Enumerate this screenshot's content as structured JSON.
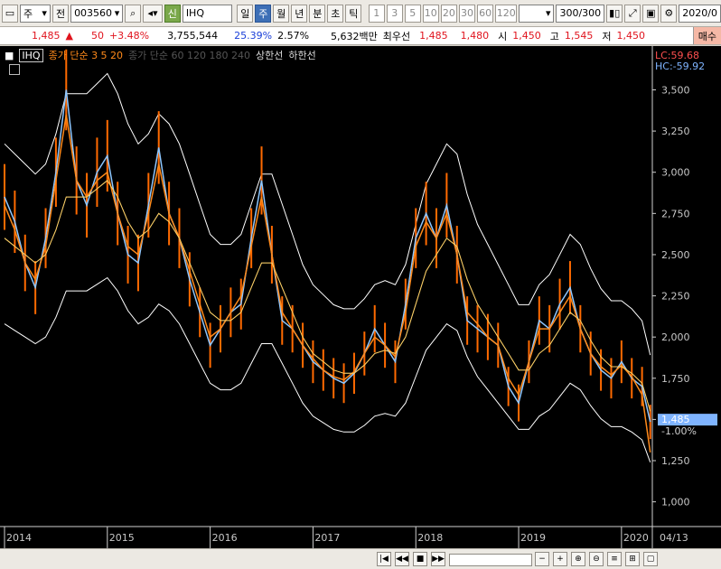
{
  "toolbar": {
    "period_label": "주",
    "market_label": "전",
    "code": "003560",
    "name_tag": "신",
    "name": "IHQ",
    "period_tabs": [
      "일",
      "주",
      "월",
      "년",
      "분",
      "초",
      "틱"
    ],
    "active_tab": "주",
    "intervals": [
      "1",
      "3",
      "5",
      "10",
      "20",
      "30",
      "60",
      "120"
    ],
    "count": "300",
    "count_total": "/300",
    "date": "2020/0"
  },
  "quote": {
    "price": "1,485",
    "change": "50",
    "pct": "+3.48%",
    "volume": "3,755,544",
    "vol_ratio": "25.39%",
    "turnover": "2.57%",
    "amount": "5,632백만",
    "best_label": "최우선",
    "best_ask": "1,485",
    "best_bid": "1,480",
    "open_label": "시",
    "open": "1,450",
    "high_label": "고",
    "high": "1,545",
    "low_label": "저",
    "low": "1,450",
    "buy_label": "매수"
  },
  "legend": {
    "code": "IHQ",
    "ma_text": "종가 단순 3  5  20",
    "ma_dim_text": "종가 단순 60  120  180  240",
    "upper": "상한선",
    "lower": "하한선"
  },
  "chart_labels": {
    "lc": "LC:59.68",
    "hc": "HC:-59.92",
    "last_price": "1,485",
    "last_pct": "-1.00%",
    "end_date": "04/13"
  },
  "colors": {
    "price_line": "#8ec7ff",
    "ma_fast": "#ff8a1a",
    "ma_mid": "#ffd060",
    "band": "#ffffff",
    "axis_text": "#c8c8c8"
  },
  "chart_data": {
    "type": "line",
    "title": "",
    "xlabel": "",
    "ylabel": "",
    "ylim": [
      850,
      3700
    ],
    "yticks": [
      1000,
      1250,
      1500,
      1750,
      2000,
      2250,
      2500,
      2750,
      3000,
      3250,
      3500
    ],
    "ytick_labels": [
      "1,000",
      "1,250",
      "1,500",
      "1,750",
      "2,000",
      "2,250",
      "2,500",
      "2,750",
      "3,000",
      "3,250",
      "3,500"
    ],
    "xlim": [
      2014.0,
      2020.3
    ],
    "xticks": [
      2014,
      2015,
      2016,
      2017,
      2018,
      2019,
      2020
    ],
    "xtick_labels": [
      "2014",
      "2015",
      "2016",
      "2017",
      "2018",
      "2019",
      "2020"
    ],
    "x": [
      2014.0,
      2014.1,
      2014.2,
      2014.3,
      2014.4,
      2014.5,
      2014.6,
      2014.7,
      2014.8,
      2014.9,
      2015.0,
      2015.1,
      2015.2,
      2015.3,
      2015.4,
      2015.5,
      2015.6,
      2015.7,
      2015.8,
      2015.9,
      2016.0,
      2016.1,
      2016.2,
      2016.3,
      2016.4,
      2016.5,
      2016.6,
      2016.7,
      2016.8,
      2016.9,
      2017.0,
      2017.1,
      2017.2,
      2017.3,
      2017.4,
      2017.5,
      2017.6,
      2017.7,
      2017.8,
      2017.9,
      2018.0,
      2018.1,
      2018.2,
      2018.3,
      2018.4,
      2018.5,
      2018.6,
      2018.7,
      2018.8,
      2018.9,
      2019.0,
      2019.1,
      2019.2,
      2019.3,
      2019.4,
      2019.5,
      2019.6,
      2019.7,
      2019.8,
      2019.9,
      2020.0,
      2020.1,
      2020.2,
      2020.28
    ],
    "series": [
      {
        "values": [
          2850,
          2700,
          2450,
          2300,
          2600,
          3000,
          3500,
          2950,
          2800,
          3000,
          3100,
          2750,
          2500,
          2450,
          2800,
          3150,
          2750,
          2600,
          2350,
          2150,
          1950,
          2050,
          2150,
          2200,
          2600,
          2950,
          2500,
          2100,
          2050,
          1950,
          1850,
          1800,
          1750,
          1720,
          1780,
          1900,
          2050,
          1950,
          1850,
          2200,
          2600,
          2750,
          2600,
          2800,
          2500,
          2100,
          2050,
          2000,
          1950,
          1700,
          1600,
          1850,
          2100,
          2050,
          2200,
          2300,
          2050,
          1900,
          1800,
          1750,
          1850,
          1750,
          1700,
          1485
        ]
      },
      {
        "values": [
          2800,
          2650,
          2450,
          2350,
          2550,
          2950,
          3350,
          2950,
          2850,
          2950,
          3000,
          2750,
          2550,
          2500,
          2750,
          3050,
          2750,
          2600,
          2400,
          2200,
          2000,
          2050,
          2150,
          2250,
          2550,
          2850,
          2500,
          2150,
          2050,
          1950,
          1870,
          1800,
          1760,
          1740,
          1790,
          1900,
          2000,
          1950,
          1880,
          2150,
          2550,
          2700,
          2600,
          2750,
          2500,
          2150,
          2080,
          2000,
          1950,
          1750,
          1650,
          1850,
          2050,
          2050,
          2150,
          2250,
          2050,
          1900,
          1820,
          1770,
          1830,
          1760,
          1650,
          1300
        ]
      },
      {
        "values": [
          2600,
          2550,
          2500,
          2450,
          2500,
          2650,
          2850,
          2850,
          2850,
          2900,
          2950,
          2850,
          2700,
          2600,
          2650,
          2750,
          2700,
          2600,
          2450,
          2300,
          2150,
          2100,
          2100,
          2150,
          2300,
          2450,
          2450,
          2300,
          2150,
          2000,
          1900,
          1850,
          1800,
          1780,
          1780,
          1830,
          1900,
          1920,
          1900,
          2000,
          2200,
          2400,
          2500,
          2600,
          2550,
          2350,
          2200,
          2100,
          2000,
          1900,
          1800,
          1800,
          1900,
          1950,
          2050,
          2150,
          2100,
          1980,
          1880,
          1820,
          1820,
          1780,
          1720,
          1550
        ]
      }
    ]
  },
  "bottom_controls": [
    "skip-back",
    "rewind",
    "stop",
    "fast-forward"
  ]
}
